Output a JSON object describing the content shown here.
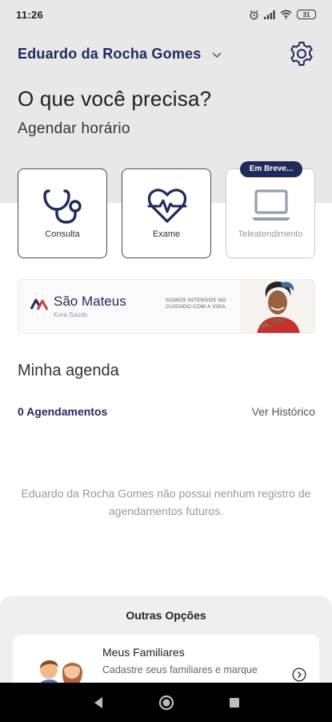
{
  "status_bar": {
    "time": "11:26",
    "battery": "31"
  },
  "header": {
    "user_name": "Eduardo da Rocha Gomes"
  },
  "main": {
    "title": "O que você precisa?",
    "subtitle": "Agendar horário",
    "cards": [
      {
        "label": "Consulta",
        "icon": "stethoscope-icon"
      },
      {
        "label": "Exame",
        "icon": "heartbeat-icon"
      },
      {
        "label": "Teleatendimento",
        "icon": "laptop-icon",
        "badge": "Em Breve..."
      }
    ]
  },
  "banner": {
    "brand": "São Mateus",
    "sub": "Kora Saúde",
    "slogan": "SOMOS INTENSOS NO CUIDADO COM A VIDA."
  },
  "agenda": {
    "title": "Minha agenda",
    "count_label": "0 Agendamentos",
    "history_link": "Ver Histórico",
    "empty_message": "Eduardo da Rocha Gomes não possui nenhum registro de agendamentos futuros."
  },
  "other_options": {
    "title": "Outras Opções",
    "items": [
      {
        "title": "Meus Familiares",
        "description": "Cadastre seus familiares e marque"
      }
    ]
  },
  "colors": {
    "brand_navy": "#1f2a5a",
    "background_gray": "#e8e8e8"
  }
}
